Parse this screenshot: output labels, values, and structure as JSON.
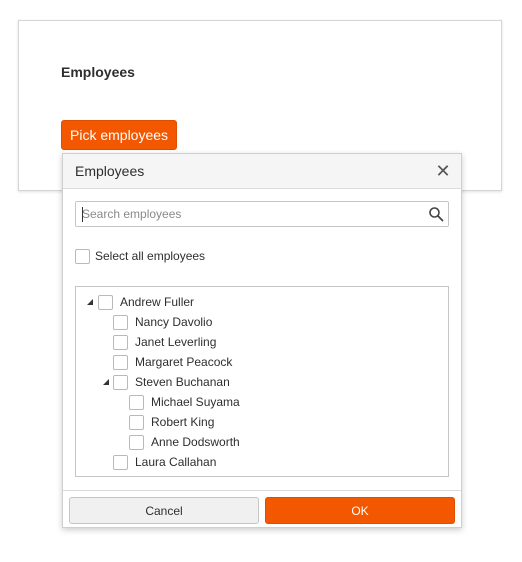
{
  "card": {
    "title": "Employees",
    "pick_button_label": "Pick employees"
  },
  "dialog": {
    "title": "Employees",
    "close_icon": "close-icon",
    "search": {
      "placeholder": "Search employees",
      "value": ""
    },
    "select_all_label": "Select all employees",
    "tree": [
      {
        "label": "Andrew Fuller",
        "level": 0,
        "expanded": true,
        "checked": false
      },
      {
        "label": "Nancy Davolio",
        "level": 1,
        "checked": false
      },
      {
        "label": "Janet Leverling",
        "level": 1,
        "checked": false
      },
      {
        "label": "Margaret Peacock",
        "level": 1,
        "checked": false
      },
      {
        "label": "Steven Buchanan",
        "level": 1,
        "expanded": true,
        "checked": false
      },
      {
        "label": "Michael Suyama",
        "level": 2,
        "checked": false
      },
      {
        "label": "Robert King",
        "level": 2,
        "checked": false
      },
      {
        "label": "Anne Dodsworth",
        "level": 2,
        "checked": false
      },
      {
        "label": "Laura Callahan",
        "level": 1,
        "checked": false
      }
    ],
    "cancel_label": "Cancel",
    "ok_label": "OK"
  },
  "colors": {
    "accent": "#f35800",
    "border": "#c5c5c5",
    "header_bg": "#f5f5f5"
  }
}
